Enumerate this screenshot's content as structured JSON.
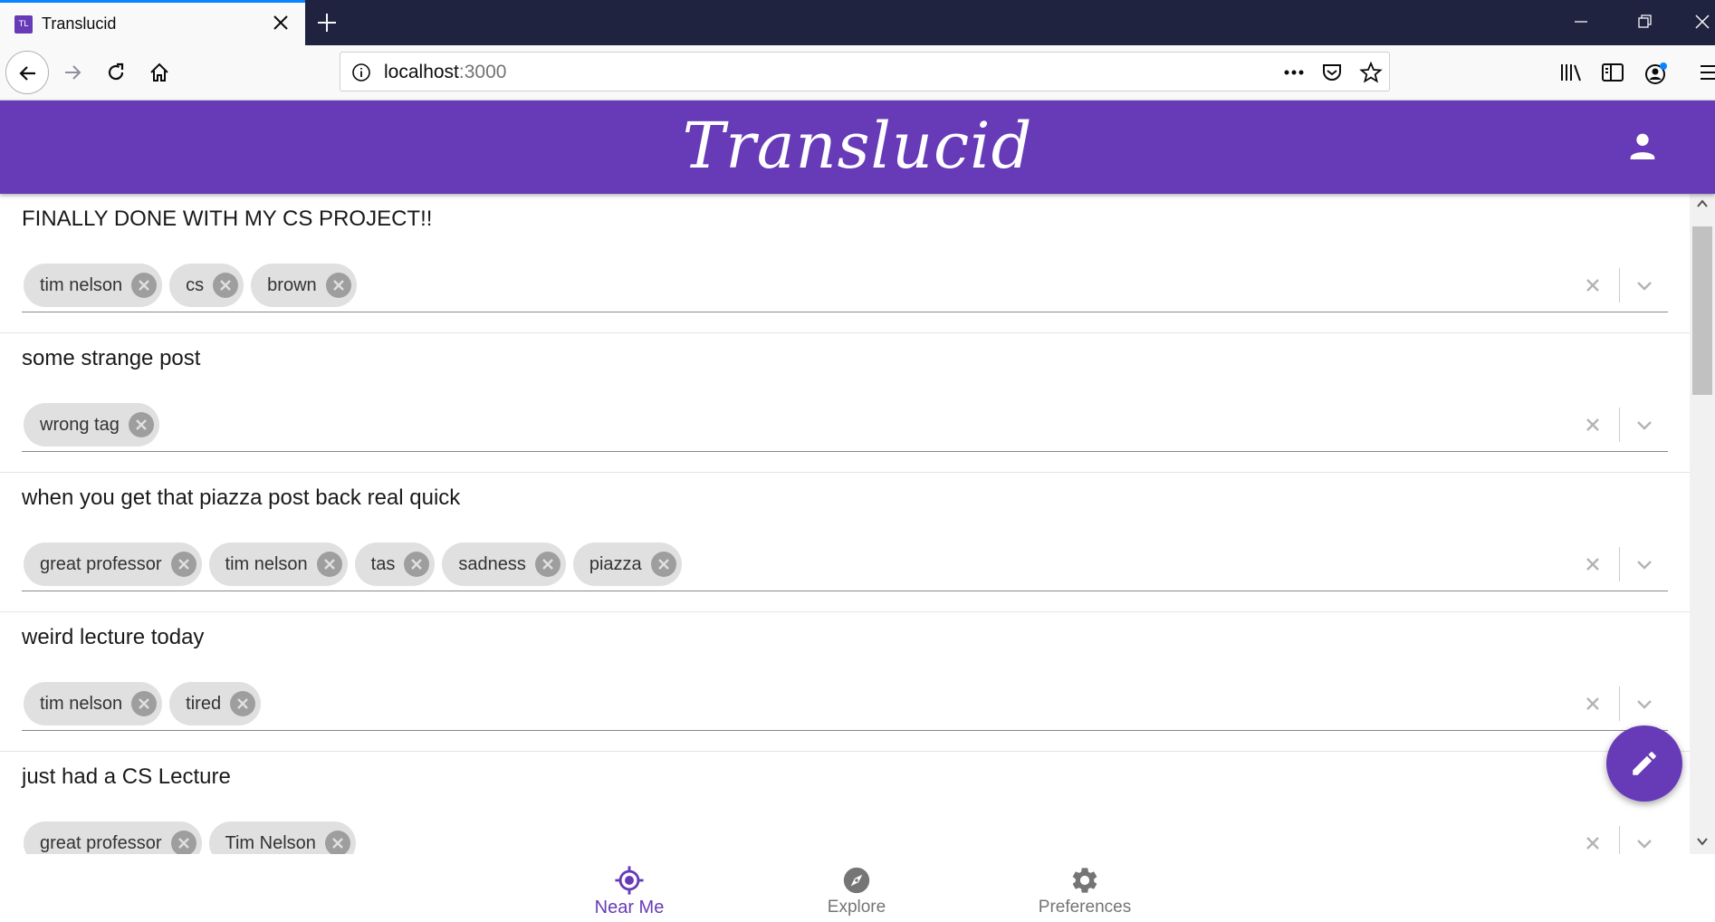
{
  "browser": {
    "tab_title": "Translucid",
    "favicon_text": "TL",
    "url_host": "localhost",
    "url_port": ":3000"
  },
  "app": {
    "title": "Translucid",
    "accent_color": "#673ab7"
  },
  "posts": [
    {
      "title": "FINALLY DONE WITH MY CS PROJECT!!",
      "tags": [
        "tim nelson",
        "cs",
        "brown"
      ]
    },
    {
      "title": "some strange post",
      "tags": [
        "wrong tag"
      ]
    },
    {
      "title": "when you get that piazza post back real quick",
      "tags": [
        "great professor",
        "tim nelson",
        "tas",
        "sadness",
        "piazza"
      ]
    },
    {
      "title": "weird lecture today",
      "tags": [
        "tim nelson",
        "tired"
      ]
    },
    {
      "title": "just had a CS Lecture",
      "tags": [
        "great professor",
        "Tim Nelson"
      ]
    }
  ],
  "bottom_nav": [
    {
      "label": "Near Me",
      "icon": "target-icon",
      "active": true
    },
    {
      "label": "Explore",
      "icon": "compass-icon",
      "active": false
    },
    {
      "label": "Preferences",
      "icon": "gear-icon",
      "active": false
    }
  ],
  "icons": {
    "fab": "pencil-icon",
    "account": "person-icon"
  }
}
